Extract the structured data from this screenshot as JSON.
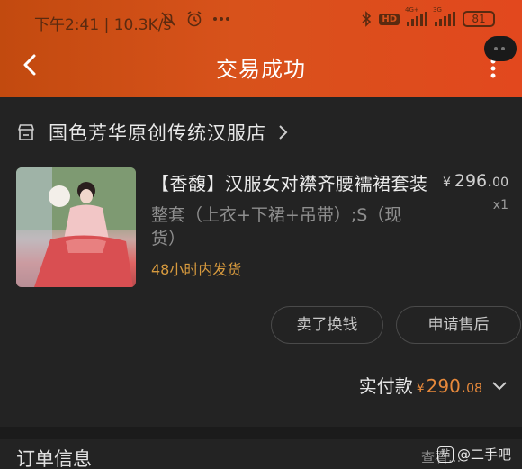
{
  "status_bar": {
    "time": "下午2:41",
    "speed": "10.3K/s",
    "hd": "HD",
    "net1": "4G+",
    "net2": "3G",
    "battery": "81"
  },
  "header": {
    "title": "交易成功"
  },
  "shop": {
    "name": "国色芳华原创传统汉服店"
  },
  "product": {
    "title": "【香馥】汉服女对襟齐腰襦裙套装",
    "price_currency": "¥",
    "price_int": "296.",
    "price_dec": "00",
    "quantity": "x1",
    "sku": "整套（上衣+下裙+吊带）;S（现货）",
    "shipping": "48小时内发货"
  },
  "actions": {
    "sell_label": "卖了换钱",
    "after_sale_label": "申请售后"
  },
  "payment": {
    "label": "实付款",
    "currency": "¥",
    "amount_int": "290.",
    "amount_dec": "08"
  },
  "order_info": {
    "title": "订单信息",
    "hint": "查看..."
  },
  "watermark": {
    "logo": "贴",
    "text": "@二手吧"
  },
  "colors": {
    "header_start": "#c24a0f",
    "header_end": "#e2481e",
    "accent_orange": "#e7893b",
    "ship_orange": "#d79a3e"
  }
}
